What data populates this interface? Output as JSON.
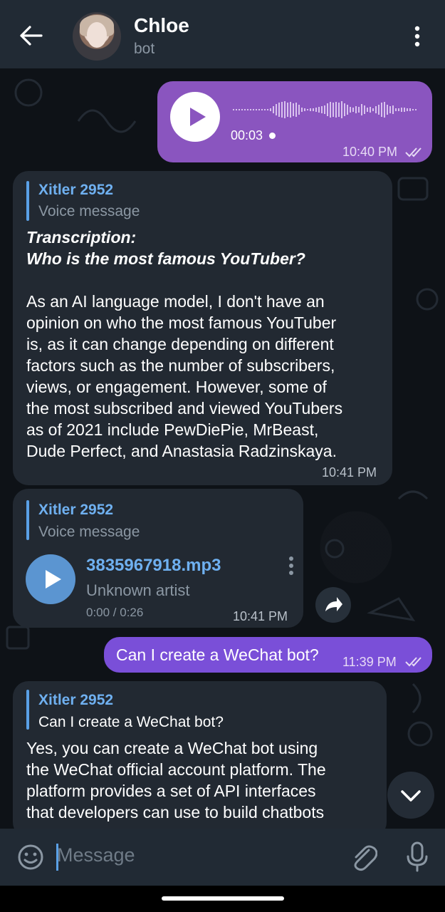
{
  "header": {
    "title": "Chloe",
    "subtitle": "bot"
  },
  "messages": {
    "voice_out": {
      "duration": "00:03",
      "time": "10:40 PM"
    },
    "reply1": {
      "reply_name": "Xitler 2952",
      "reply_sub": "Voice message",
      "transcription_label": "Transcription:",
      "transcription_question": "Who is the most famous YouTuber?",
      "lines": [
        "As an AI language model, I don't have an",
        "opinion on who the most famous YouTuber",
        "is, as it can change depending on different",
        "factors such as the number of subscribers,",
        "views, or engagement. However, some of",
        "the most subscribed and viewed YouTubers",
        "as of 2021 include PewDiePie, MrBeast,",
        "Dude Perfect, and Anastasia Radzinskaya."
      ],
      "time": "10:41 PM"
    },
    "audio_in": {
      "reply_name": "Xitler 2952",
      "reply_sub": "Voice message",
      "file_name": "3835967918.mp3",
      "artist": "Unknown artist",
      "progress": "0:00 / 0:26",
      "time": "10:41 PM"
    },
    "text_out": {
      "text": "Can I create a WeChat bot?",
      "time": "11:39 PM"
    },
    "reply2": {
      "reply_name": "Xitler 2952",
      "reply_sub": "Can I create a WeChat bot?",
      "lines": [
        "Yes, you can create a WeChat bot using",
        "the WeChat official account platform. The",
        "platform provides a set of API interfaces",
        "that developers can use to build chatbots"
      ]
    }
  },
  "input": {
    "placeholder": "Message"
  },
  "colors": {
    "header_bg": "#212a34",
    "outgoing_voice": "#8a55bf",
    "outgoing_text": "#7a4fd8",
    "incoming": "#222932",
    "accent_blue": "#5aa0e6"
  }
}
